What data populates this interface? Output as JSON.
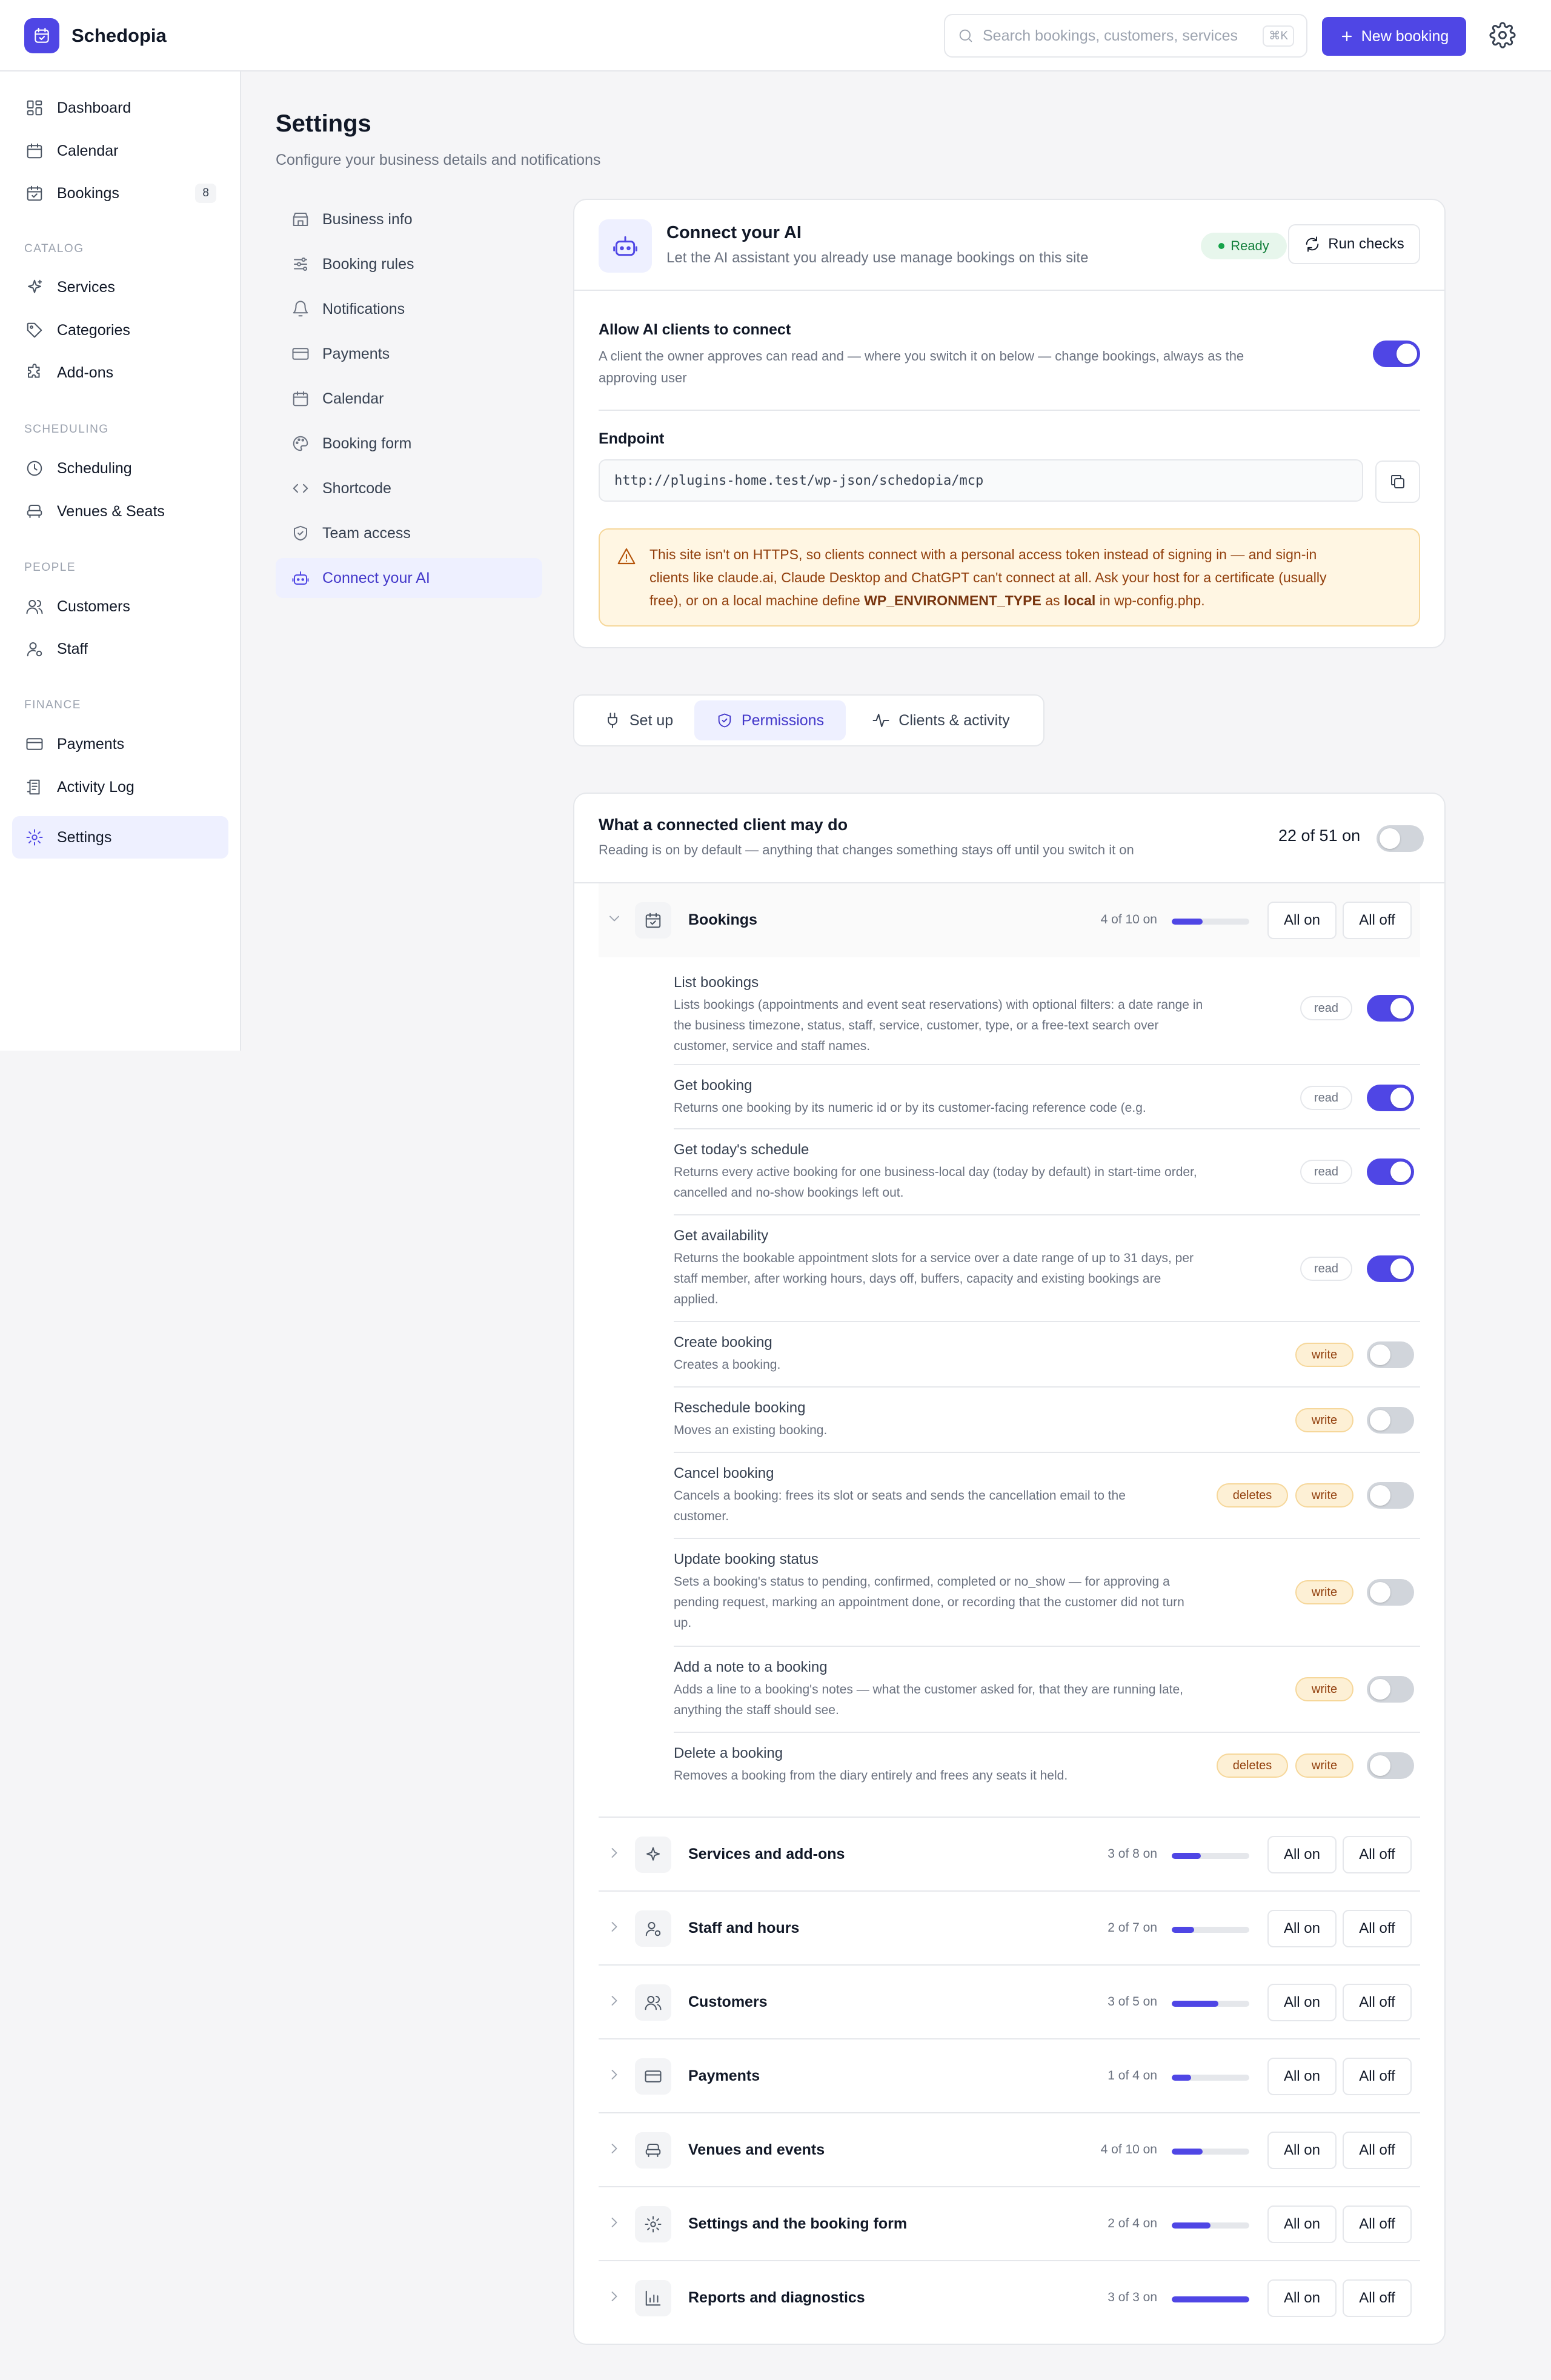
{
  "app": {
    "name": "Schedopia",
    "search_placeholder": "Search bookings, customers, services",
    "search_shortcut": "⌘K",
    "new_booking_label": "New booking"
  },
  "sidebar": {
    "items": [
      {
        "label": "Dashboard",
        "icon": "dashboard-icon"
      },
      {
        "label": "Calendar",
        "icon": "calendar-icon"
      },
      {
        "label": "Bookings",
        "icon": "bookings-icon",
        "badge": "8"
      }
    ],
    "sections": [
      {
        "title": "CATALOG",
        "items": [
          {
            "label": "Services",
            "icon": "sparkle-icon"
          },
          {
            "label": "Categories",
            "icon": "tag-icon"
          },
          {
            "label": "Add-ons",
            "icon": "puzzle-icon"
          }
        ]
      },
      {
        "title": "SCHEDULING",
        "items": [
          {
            "label": "Scheduling",
            "icon": "clock-icon"
          },
          {
            "label": "Venues & Seats",
            "icon": "seat-icon"
          }
        ]
      },
      {
        "title": "PEOPLE",
        "items": [
          {
            "label": "Customers",
            "icon": "users-icon"
          },
          {
            "label": "Staff",
            "icon": "staff-icon"
          }
        ]
      },
      {
        "title": "FINANCE",
        "items": [
          {
            "label": "Payments",
            "icon": "card-icon"
          },
          {
            "label": "Activity Log",
            "icon": "log-icon"
          }
        ]
      }
    ],
    "settings_label": "Settings"
  },
  "page": {
    "title": "Settings",
    "subtitle": "Configure your business details and notifications"
  },
  "settings_nav": [
    {
      "label": "Business info",
      "icon": "store-icon"
    },
    {
      "label": "Booking rules",
      "icon": "sliders-icon"
    },
    {
      "label": "Notifications",
      "icon": "bell-icon"
    },
    {
      "label": "Payments",
      "icon": "card-icon"
    },
    {
      "label": "Calendar",
      "icon": "calendar-icon"
    },
    {
      "label": "Booking form",
      "icon": "palette-icon"
    },
    {
      "label": "Shortcode",
      "icon": "code-icon"
    },
    {
      "label": "Team access",
      "icon": "shield-icon"
    },
    {
      "label": "Connect your AI",
      "icon": "robot-icon",
      "active": true
    }
  ],
  "connect_ai": {
    "title": "Connect your AI",
    "subtitle": "Let the AI assistant you already use manage bookings on this site",
    "status": "Ready",
    "run_checks_label": "Run checks",
    "allow_title": "Allow AI clients to connect",
    "allow_desc_1": "A client the owner approves can read and — where you switch it on below — change bookings, always as the",
    "allow_desc_2": "approving user",
    "allow_enabled": true,
    "endpoint_label": "Endpoint",
    "endpoint_value": "http://plugins-home.test/wp-json/schedopia/mcp",
    "warning_1": "This site isn't on HTTPS, so clients connect with a personal access token instead of signing in — and sign-in",
    "warning_2": "clients like claude.ai, Claude Desktop and ChatGPT can't connect at all. Ask your host for a certificate (usually",
    "warning_3a": "free), or on a local machine define ",
    "warning_3b": "WP_ENVIRONMENT_TYPE",
    "warning_3c": " as ",
    "warning_3d": "local",
    "warning_3e": " in wp-config.php."
  },
  "tabs": [
    {
      "label": "Set up",
      "icon": "plug-icon"
    },
    {
      "label": "Permissions",
      "icon": "shield-icon",
      "active": true
    },
    {
      "label": "Clients & activity",
      "icon": "activity-icon"
    }
  ],
  "permissions": {
    "title": "What a connected client may do",
    "subtitle": "Reading is on by default — anything that changes something stays off until you switch it on",
    "count_label": "22 of 51 on",
    "all_on_label": "All on",
    "all_off_label": "All off",
    "groups": [
      {
        "name": "Bookings",
        "count": "4 of 10 on",
        "fraction": 0.4,
        "icon": "bookings-icon",
        "expanded": true
      },
      {
        "name": "Services and add-ons",
        "count": "3 of 8 on",
        "fraction": 0.375,
        "icon": "sparkle-icon"
      },
      {
        "name": "Staff and hours",
        "count": "2 of 7 on",
        "fraction": 0.286,
        "icon": "staff-icon"
      },
      {
        "name": "Customers",
        "count": "3 of 5 on",
        "fraction": 0.6,
        "icon": "users-icon"
      },
      {
        "name": "Payments",
        "count": "1 of 4 on",
        "fraction": 0.25,
        "icon": "card-icon"
      },
      {
        "name": "Venues and events",
        "count": "4 of 10 on",
        "fraction": 0.4,
        "icon": "seat-icon"
      },
      {
        "name": "Settings and the booking form",
        "count": "2 of 4 on",
        "fraction": 0.5,
        "icon": "gear-icon"
      },
      {
        "name": "Reports and diagnostics",
        "count": "3 of 3 on",
        "fraction": 1.0,
        "icon": "chart-icon"
      }
    ],
    "tools": [
      {
        "name": "List bookings",
        "desc": [
          "Lists bookings (appointments and event seat reservations) with optional filters: a date range in",
          "the business timezone, status, staff, service, customer, type, or a free-text search over",
          "customer, service and staff names."
        ],
        "tags": [
          "read"
        ],
        "on": true
      },
      {
        "name": "Get booking",
        "desc": [
          "Returns one booking by its numeric id or by its customer-facing reference code (e.g."
        ],
        "tags": [
          "read"
        ],
        "on": true
      },
      {
        "name": "Get today's schedule",
        "desc": [
          "Returns every active booking for one business-local day (today by default) in start-time order,",
          "cancelled and no-show bookings left out."
        ],
        "tags": [
          "read"
        ],
        "on": true
      },
      {
        "name": "Get availability",
        "desc": [
          "Returns the bookable appointment slots for a service over a date range of up to 31 days, per",
          "staff member, after working hours, days off, buffers, capacity and existing bookings are",
          "applied."
        ],
        "tags": [
          "read"
        ],
        "on": true
      },
      {
        "name": "Create booking",
        "desc": [
          "Creates a booking."
        ],
        "tags": [
          "write"
        ],
        "on": false
      },
      {
        "name": "Reschedule booking",
        "desc": [
          "Moves an existing booking."
        ],
        "tags": [
          "write"
        ],
        "on": false
      },
      {
        "name": "Cancel booking",
        "desc": [
          "Cancels a booking: frees its slot or seats and sends the cancellation email to the",
          "customer."
        ],
        "tags": [
          "deletes",
          "write"
        ],
        "on": false
      },
      {
        "name": "Update booking status",
        "desc": [
          "Sets a booking's status to pending, confirmed, completed or no_show — for approving a",
          "pending request, marking an appointment done, or recording that the customer did not turn",
          "up."
        ],
        "tags": [
          "write"
        ],
        "on": false
      },
      {
        "name": "Add a note to a booking",
        "desc": [
          "Adds a line to a booking's notes — what the customer asked for, that they are running late,",
          "anything the staff should see."
        ],
        "tags": [
          "write"
        ],
        "on": false
      },
      {
        "name": "Delete a booking",
        "desc": [
          "Removes a booking from the diary entirely and frees any seats it held."
        ],
        "tags": [
          "deletes",
          "write"
        ],
        "on": false
      }
    ]
  },
  "colors": {
    "accent": "#4f46e5",
    "ready": "#16a34a",
    "warning_bg": "#fff6e3"
  }
}
